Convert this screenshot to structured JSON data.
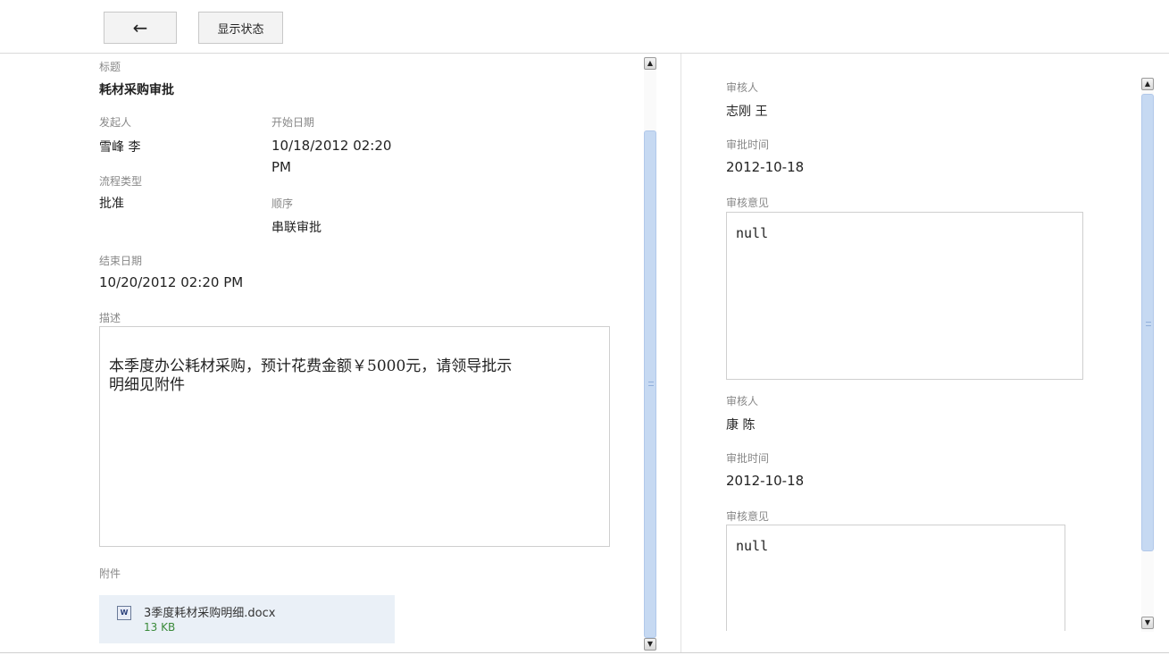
{
  "toolbar": {
    "back_icon": "←",
    "status_label": "显示状态"
  },
  "left": {
    "title_label": "标题",
    "title_value": "耗材采购审批",
    "initiator_label": "发起人",
    "initiator_value": "雪峰 李",
    "start_date_label": "开始日期",
    "start_date_line1": "10/18/2012 02:20",
    "start_date_line2": "PM",
    "flow_type_label": "流程类型",
    "flow_type_value": "批准",
    "order_label": "顺序",
    "order_value": "串联审批",
    "end_date_label": "结束日期",
    "end_date_value": "10/20/2012 02:20 PM",
    "description_label": "描述",
    "description_line1": "本季度办公耗材采购，预计花费金额￥5000元，请领导批示",
    "description_line2": "明细见附件",
    "attachment_label": "附件",
    "attachment": {
      "icon": "word-doc-icon",
      "name": "3季度耗材采购明细.docx",
      "size": "13 KB"
    }
  },
  "right": {
    "reviews": [
      {
        "reviewer_label": "审核人",
        "reviewer": "志刚 王",
        "time_label": "审批时间",
        "time": "2012-10-18",
        "opinion_label": "审核意见",
        "opinion": "null"
      },
      {
        "reviewer_label": "审核人",
        "reviewer": "康 陈",
        "time_label": "审批时间",
        "time": "2012-10-18",
        "opinion_label": "审核意见",
        "opinion": "null"
      }
    ]
  },
  "colors": {
    "scroll_thumb": "#c6d9f2",
    "attachment_bg": "#eaf0f7",
    "size_text": "#3a8a3a"
  }
}
